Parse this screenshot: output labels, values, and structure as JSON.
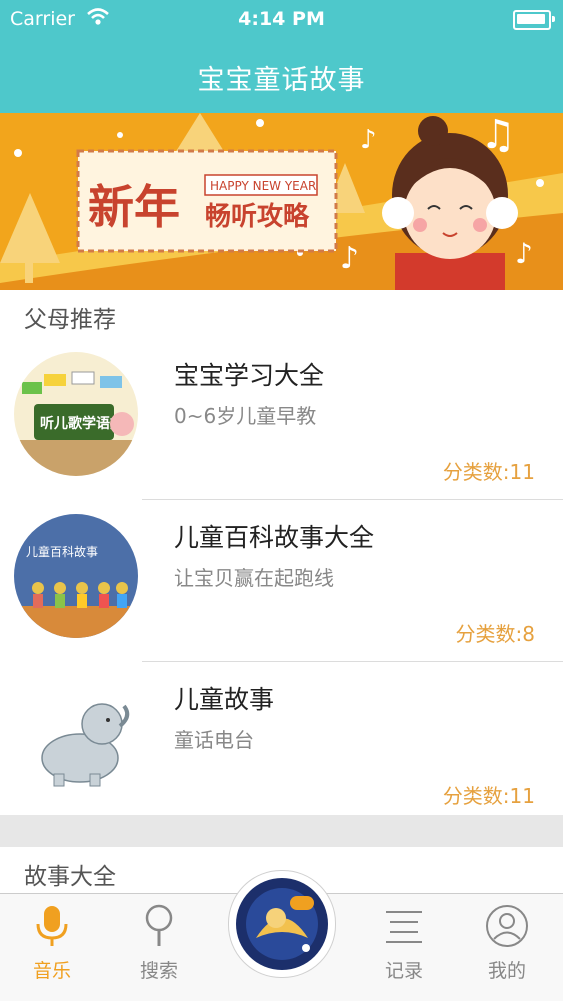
{
  "status_bar": {
    "carrier": "Carrier",
    "time": "4:14 PM"
  },
  "nav": {
    "title": "宝宝童话故事"
  },
  "banner": {
    "title": "新年",
    "badge": "HAPPY NEW YEAR",
    "subtitle": "畅听攻略"
  },
  "parents_section": {
    "label": "父母推荐"
  },
  "recommendations": [
    {
      "title": "宝宝学习大全",
      "subtitle": "0~6岁儿童早教",
      "count": "分类数:11",
      "thumb_text": "听儿歌学语文"
    },
    {
      "title": "儿童百科故事大全",
      "subtitle": "让宝贝赢在起跑线",
      "count": "分类数:8",
      "thumb_text": "儿童百科故事"
    },
    {
      "title": "儿童故事",
      "subtitle": "童话电台",
      "count": "分类数:11"
    }
  ],
  "stories_section": {
    "label": "故事大全"
  },
  "tabs": [
    {
      "label": "音乐",
      "icon": "microphone-icon",
      "active": true
    },
    {
      "label": "搜索",
      "icon": "search-icon",
      "active": false
    },
    {
      "label": "记录",
      "icon": "list-icon",
      "active": false
    },
    {
      "label": "我的",
      "icon": "user-icon",
      "active": false
    }
  ],
  "colors": {
    "primary": "#4ec8cb",
    "accent": "#e6a13f",
    "banner_orange": "#f0a51c"
  }
}
